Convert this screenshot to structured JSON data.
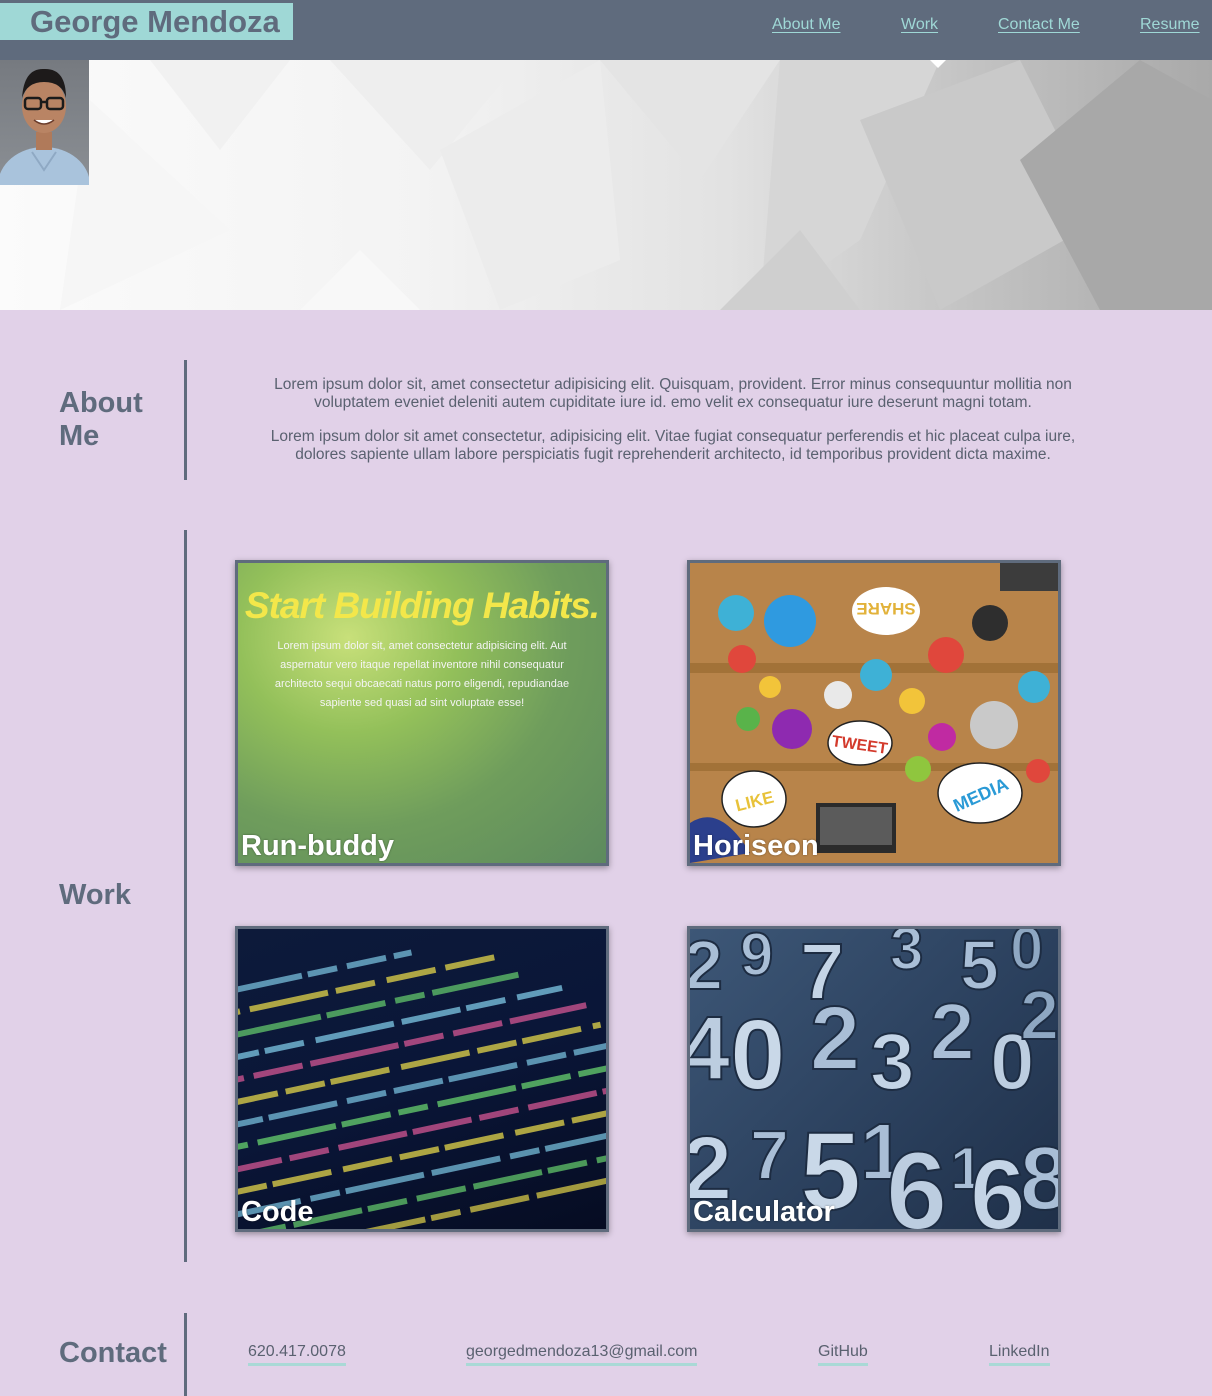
{
  "header": {
    "brand": "George Mendoza",
    "nav": [
      "About Me",
      "Work",
      "Contact Me",
      "Resume"
    ]
  },
  "hero": {
    "avatar_icon": "profile-photo"
  },
  "about": {
    "title": "About Me",
    "paragraphs": [
      "Lorem ipsum dolor sit, amet consectetur adipisicing elit. Quisquam, provident. Error minus consequuntur mollitia non voluptatem eveniet deleniti autem cupiditate iure id. emo velit ex consequatur iure deserunt magni totam.",
      "Lorem ipsum dolor sit amet consectetur, adipisicing elit. Vitae fugiat consequatur perferendis et hic placeat culpa iure, dolores sapiente ullam labore perspiciatis fugit reprehenderit architecto, id temporibus provident dicta maxime."
    ]
  },
  "work": {
    "title": "Work",
    "projects": [
      {
        "name": "Run-buddy",
        "image_headline": "Start Building Habits.",
        "image_text": "Lorem ipsum dolor sit, amet consectetur adipisicing elit. Aut aspernatur vero itaque repellat inventore nihil consequatur architecto sequi obcaecati natus porro eligendi, repudiandae sapiente sed quasi ad sint voluptate esse!"
      },
      {
        "name": "Horiseon",
        "image_words": [
          "SHARE",
          "TWEET",
          "LIKE",
          "MEDIA"
        ]
      },
      {
        "name": "Code"
      },
      {
        "name": "Calculator"
      }
    ]
  },
  "contact": {
    "title": "Contact",
    "links": [
      "620.417.0078",
      "georgedmendoza13@gmail.com",
      "GitHub",
      "LinkedIn"
    ]
  },
  "colors": {
    "header_bg": "#5f6b7d",
    "brand_bg": "#9fd8d6",
    "page_bg": "#e1d1e8",
    "accent_line": "#a9d9d6"
  }
}
